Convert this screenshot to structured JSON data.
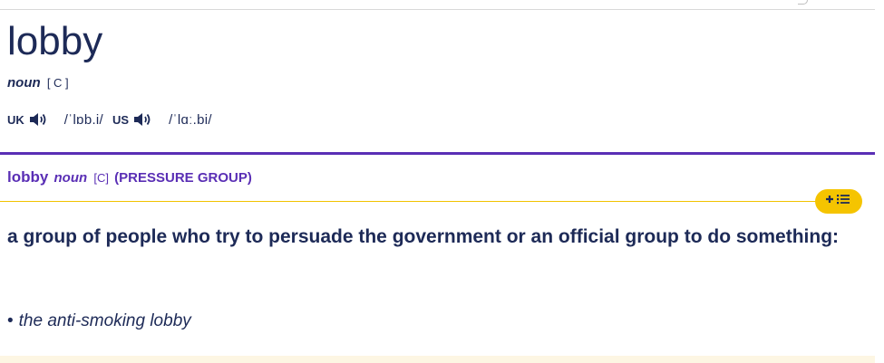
{
  "entry": {
    "headword": "lobby",
    "part_of_speech": "noun",
    "grammar_code": "[ C ]"
  },
  "pronunciations": [
    {
      "region": "UK",
      "ipa": "/ˈlɒb.i/",
      "icon": "speaker-icon"
    },
    {
      "region": "US",
      "ipa": "/ˈlɑː.bi/",
      "icon": "speaker-icon"
    }
  ],
  "sense": {
    "headword": "lobby",
    "part_of_speech": "noun",
    "grammar_code": "[C]",
    "guideword": "(PRESSURE GROUP)",
    "definition": "a group of people who try to persuade the government or an official group to do something:",
    "examples": [
      {
        "bullet": "•",
        "text": "the anti-smoking lobby"
      }
    ],
    "add_to_list_icon": "plus-list-icon"
  },
  "colors": {
    "text_navy": "#1d2a57",
    "accent_purple": "#5a2fb5",
    "accent_yellow": "#f5c400",
    "rule_yellow": "#f2c200"
  }
}
